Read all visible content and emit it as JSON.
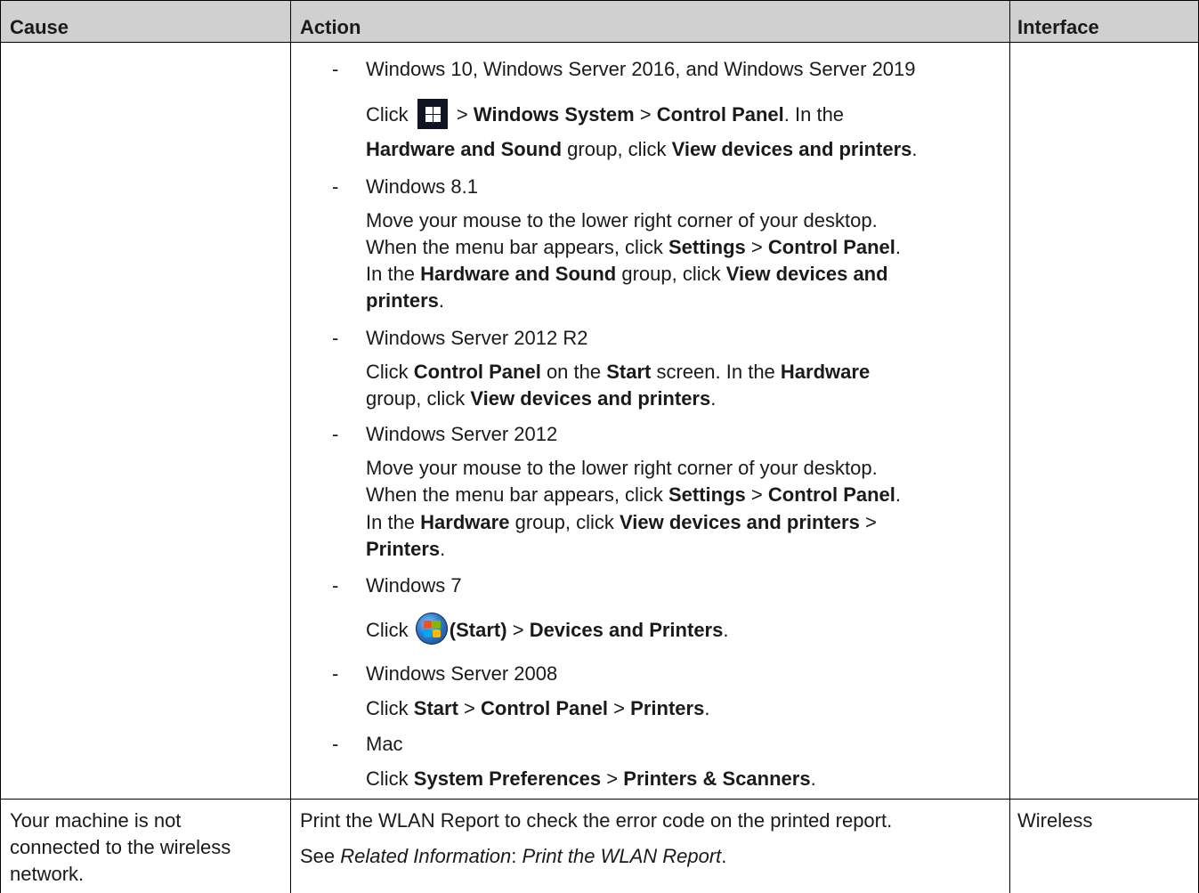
{
  "headers": {
    "cause": "Cause",
    "action": "Action",
    "interface": "Interface"
  },
  "row1": {
    "items": [
      {
        "os": "Windows 10, Windows Server 2016, and Windows Server 2019"
      },
      {
        "os": "Windows 8.1"
      },
      {
        "os": "Windows Server 2012 R2"
      },
      {
        "os": "Windows Server 2012"
      },
      {
        "os": "Windows 7"
      },
      {
        "os": "Windows Server 2008"
      },
      {
        "os": "Mac"
      }
    ],
    "dash": "-",
    "click": "Click",
    "gt": ">",
    "period": ".",
    "win10": {
      "windows_system": "Windows System",
      "control_panel": "Control Panel",
      "in_the": ". In the",
      "hw_sound": "Hardware and Sound",
      "group_click": "group, click",
      "view_devices": "View devices and printers"
    },
    "win81": {
      "line1": "Move your mouse to the lower right corner of your desktop.",
      "when": "When the menu bar appears, click",
      "settings": "Settings",
      "control_panel": "Control Panel",
      "in_the": "In the",
      "hw_sound": "Hardware and Sound",
      "group_click": "group, click",
      "view_devices_and": "View devices and",
      "printers": "printers"
    },
    "ws2012r2": {
      "control_panel": "Control Panel",
      "on_the": "on the",
      "start": "Start",
      "screen_in_the": "screen. In the",
      "hardware": "Hardware",
      "group_click": "group, click",
      "view_devices": "View devices and printers"
    },
    "ws2012": {
      "line1": "Move your mouse to the lower right corner of your desktop.",
      "when": "When the menu bar appears, click",
      "settings": "Settings",
      "control_panel": "Control Panel",
      "in_the": "In the",
      "hardware": "Hardware",
      "group_click": "group, click",
      "view_devices": "View devices and printers",
      "printers": "Printers"
    },
    "win7": {
      "start": "(Start)",
      "devices_printers": "Devices and Printers"
    },
    "ws2008": {
      "start": "Start",
      "control_panel": "Control Panel",
      "printers": "Printers"
    },
    "mac": {
      "system_prefs": "System Preferences",
      "printers_scanners": "Printers & Scanners"
    }
  },
  "row2": {
    "cause_lines": [
      "Your machine is not",
      "connected to the wireless",
      "network."
    ],
    "action1": "Print the WLAN Report to check the error code on the printed report.",
    "see": "See",
    "related": "Related Information",
    "colon": ":",
    "print_wlan": "Print the WLAN Report",
    "interface": "Wireless"
  },
  "icons": {
    "start_button_win10": "windows-logo-icon",
    "start_button_win7": "windows7-orb-icon"
  },
  "colors": {
    "header_bg": "#d0d0d0",
    "border": "#000000",
    "text": "#1a1a1a"
  }
}
